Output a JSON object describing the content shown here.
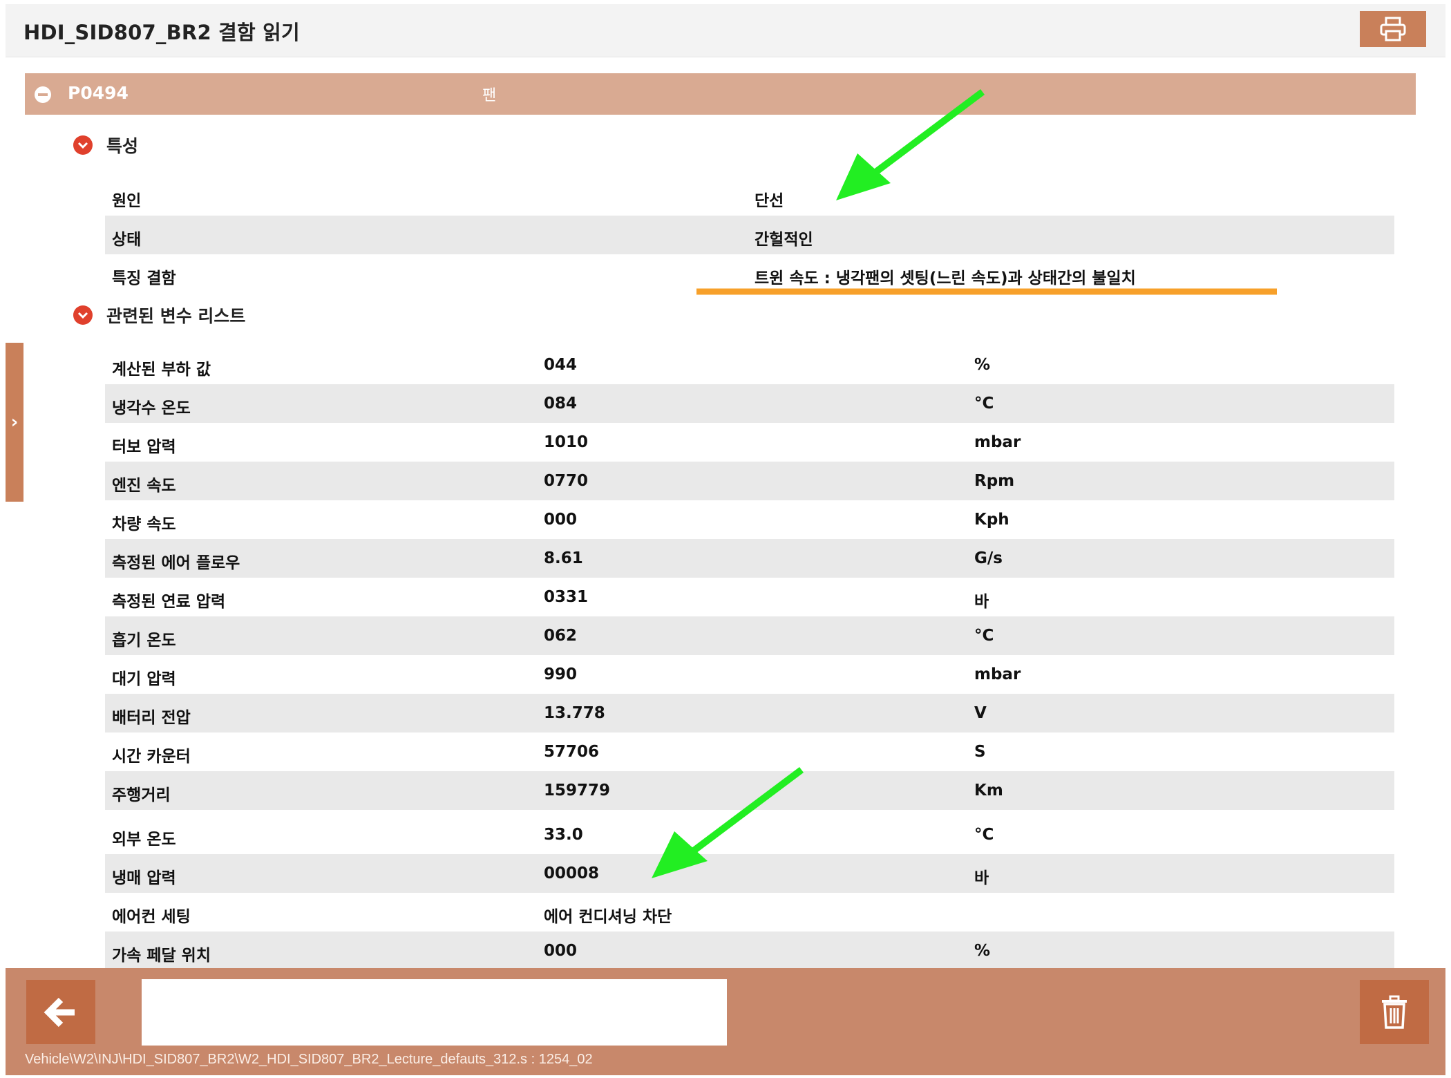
{
  "window": {
    "title": "HDI_SID807_BR2 결함 읽기",
    "print_icon": "printer-icon"
  },
  "dtc": {
    "code": "P0494",
    "description": "팬"
  },
  "characteristics": {
    "title": "특성",
    "rows": [
      {
        "label": "원인",
        "value": "단선"
      },
      {
        "label": "상태",
        "value": "간헐적인"
      },
      {
        "label": "특징 결함",
        "value": "트윈 속도 : 냉각팬의 셋팅(느린 속도)과 상태간의 불일치"
      }
    ]
  },
  "variables": {
    "title": "관련된 변수 리스트",
    "rows": [
      {
        "label": "계산된 부하 값",
        "value": "044",
        "unit": "%"
      },
      {
        "label": "냉각수 온도",
        "value": "084",
        "unit": "°C"
      },
      {
        "label": "터보 압력",
        "value": "1010",
        "unit": "mbar"
      },
      {
        "label": "엔진 속도",
        "value": "0770",
        "unit": "Rpm"
      },
      {
        "label": "차량 속도",
        "value": "000",
        "unit": "Kph"
      },
      {
        "label": "측정된 에어 플로우",
        "value": "8.61",
        "unit": "G/s"
      },
      {
        "label": "측정된 연료 압력",
        "value": "0331",
        "unit": "바"
      },
      {
        "label": "흡기 온도",
        "value": "062",
        "unit": "°C"
      },
      {
        "label": "대기 압력",
        "value": "990",
        "unit": "mbar"
      },
      {
        "label": "배터리 전압",
        "value": "13.778",
        "unit": "V"
      },
      {
        "label": "시간 카운터",
        "value": "57706",
        "unit": "S"
      },
      {
        "label": "주행거리",
        "value": "159779",
        "unit": "Km"
      },
      {
        "label": "외부 온도",
        "value": "33.0",
        "unit": "°C"
      },
      {
        "label": "냉매 압력",
        "value": "00008",
        "unit": "바"
      },
      {
        "label": "에어컨 세팅",
        "value": "에어 컨디셔닝 차단",
        "unit": ""
      },
      {
        "label": "가속 페달 위치",
        "value": "000",
        "unit": "%"
      }
    ]
  },
  "bottom": {
    "back_icon": "arrow-left-icon",
    "trash_icon": "trash-icon",
    "message": "",
    "path": "Vehicle\\W2\\INJ\\HDI_SID807_BR2\\W2_HDI_SID807_BR2_Lecture_defauts_312.s : 1254_02"
  },
  "colors": {
    "accent": "#c9805a",
    "header": "#d9aa92",
    "row_shade": "#e9e9e9",
    "arrow_annotation": "#22ee22",
    "underline_annotation": "#f7a02a"
  }
}
